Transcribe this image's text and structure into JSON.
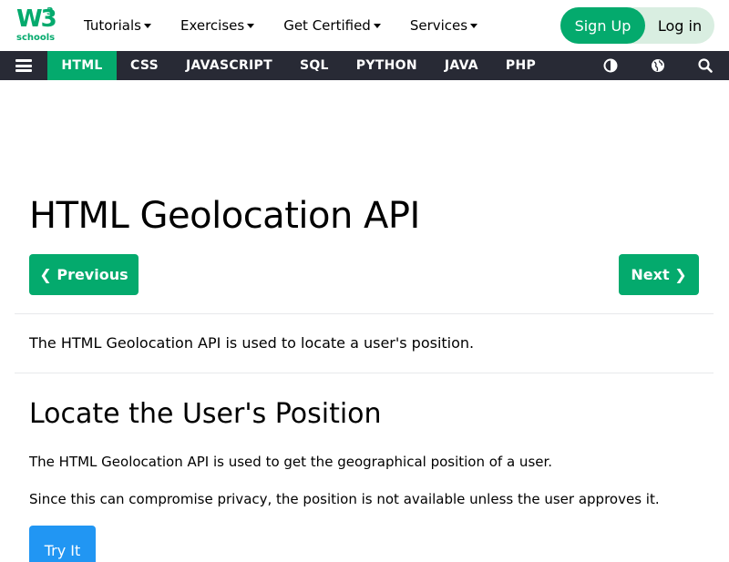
{
  "brand": {
    "logo_text": "W3",
    "logo_sup": "3",
    "logo_sub": "schools",
    "accent": "#04AA6D"
  },
  "topnav": {
    "items": [
      {
        "label": "Tutorials"
      },
      {
        "label": "Exercises"
      },
      {
        "label": "Get Certified"
      },
      {
        "label": "Services"
      }
    ],
    "signup_label": "Sign Up",
    "login_label": "Log in"
  },
  "langnav": {
    "items": [
      {
        "label": "HTML",
        "active": true
      },
      {
        "label": "CSS"
      },
      {
        "label": "JAVASCRIPT"
      },
      {
        "label": "SQL"
      },
      {
        "label": "PYTHON"
      },
      {
        "label": "JAVA"
      },
      {
        "label": "PHP"
      }
    ],
    "icons": [
      "contrast-icon",
      "globe-icon",
      "search-icon"
    ]
  },
  "content": {
    "title": "HTML Geolocation API",
    "prev_label": "❮ Previous",
    "next_label": "Next ❯",
    "intro": "The HTML Geolocation API is used to locate a user's position.",
    "section_title": "Locate the User's Position",
    "para1": "The HTML Geolocation API is used to get the geographical position of a user.",
    "para2": "Since this can compromise privacy, the position is not available unless the user approves it.",
    "tryit_label": "Try It"
  }
}
